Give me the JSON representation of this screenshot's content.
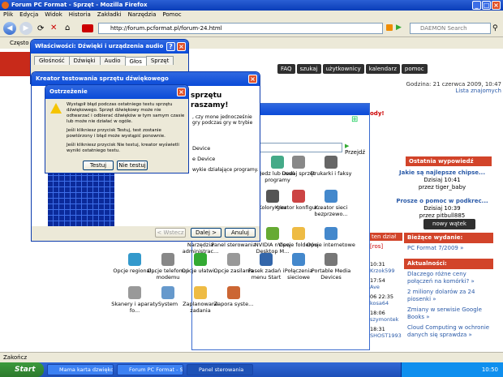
{
  "firefox": {
    "title": "Forum PC Format - Sprzęt - Mozilla Firefox",
    "menu": [
      "Plik",
      "Edycja",
      "Widok",
      "Historia",
      "Zakładki",
      "Narzędzia",
      "Pomoc"
    ],
    "url": "http://forum.pcformat.pl/forum-24.html",
    "search_placeholder": "DAEMON Search",
    "bookmarks_label": "Często o",
    "status": "Zakończ"
  },
  "forum": {
    "nav": [
      "FAQ",
      "szukaj",
      "użytkownicy",
      "kalendarz",
      "pomoc"
    ],
    "date_label": "Godzina: 21 czerwca 2009, 10:47",
    "online_link": "Lista znajomych",
    "ostatnia_header": "Ostatnia wypowiedź",
    "posts": [
      {
        "title": "Jakie są najlepsze chipse...",
        "date": "Dzisiaj 10:41",
        "by": "przez tiger_baby"
      },
      {
        "title": "Prosze o pomoc w podkrec...",
        "date": "Dzisiaj 10:39",
        "by": "przez pitbull885"
      }
    ],
    "new_topic": "nowy wątek",
    "biezace_header": "Bieżące wydanie:",
    "biezace_link": "PC Format 7/2009 »",
    "aktualnosci_header": "Aktualności:",
    "news": [
      "Dlaczego różne ceny połączeń na komórki? »",
      "2 miliony dolarów za 24 piosenki »",
      "Zmiany w serwisie Google Books »",
      "Cloud Computing w ochronie danych się sprawdza »"
    ],
    "mid_items": [
      "10:31",
      "Krzok599",
      "17:54",
      "Ave",
      "06 22:35",
      "kosa64",
      "18:06",
      "szymontek",
      "18:31",
      "SHOST1993"
    ],
    "ten_dzial": "ten dział",
    "ros": "[ros]",
    "dy": "ody!"
  },
  "control_panel": {
    "przejdz": "Przejdź",
    "icons": [
      "Jedz lub usuń programy",
      "Dodaj sprzęt",
      "Drukarki i faksy",
      "Kolory gier",
      "Kreator konfigur...",
      "Kreator sieci bezprzewo...",
      "Narzędzia administrac...",
      "Panel sterowania",
      "NVIDIA nView Desktop M...",
      "Opcje folderów",
      "Opcje internetowe",
      "Opcje regional...",
      "Opcje telefonu i modemu",
      "Opcje ułatwi...",
      "Opcje zasilania",
      "Pasek zadań i menu Start",
      "Połączenia sieciowe",
      "Portable Media Devices",
      "Skanery i aparaty fo...",
      "System",
      "Zaplanowane zadania",
      "Zapora syste..."
    ]
  },
  "audio_props": {
    "title": "Właściwości: Dźwięki i urządzenia audio",
    "tabs": [
      "Głośność",
      "Dźwięki",
      "Audio",
      "Głos",
      "Sprzęt"
    ]
  },
  "wizard": {
    "title": "Kreator testowania sprzętu dźwiękowego",
    "heading": "sprzętu",
    "heading2": "raszamy!",
    "text1": ", czy mone jednocześnie",
    "text2": "gry podczas gry w trybie",
    "text3": "Device",
    "text4": "e Device",
    "text5": "wykie działające programy.",
    "back": "< Wstecz",
    "next": "Dalej >",
    "cancel": "Anuluj"
  },
  "warning": {
    "title": "Ostrzeżenie",
    "p1": "Wystąpił błąd podczas ostatniego testu sprzętu dźwiękowego. Sprzęt dźwiękowy może nie odtwarzać i odbierać dźwięków w tym samym czasie lub może nie działać w ogóle.",
    "p2": "Jeśli klikniesz przycisk Testuj, test zostanie powtórzony i błąd może wystąpić ponownie.",
    "p3": "Jeśli klikniesz przycisk Nie testuj, kreator wyświetli wyniki ostatniego testu.",
    "btn_test": "Testuj",
    "btn_notest": "Nie testuj"
  },
  "taskbar": {
    "start": "Start",
    "tasks": [
      "Mama karta dzwięko...",
      "Forum PC Format - S...",
      "Panel sterowania"
    ],
    "clock": "10:50"
  }
}
